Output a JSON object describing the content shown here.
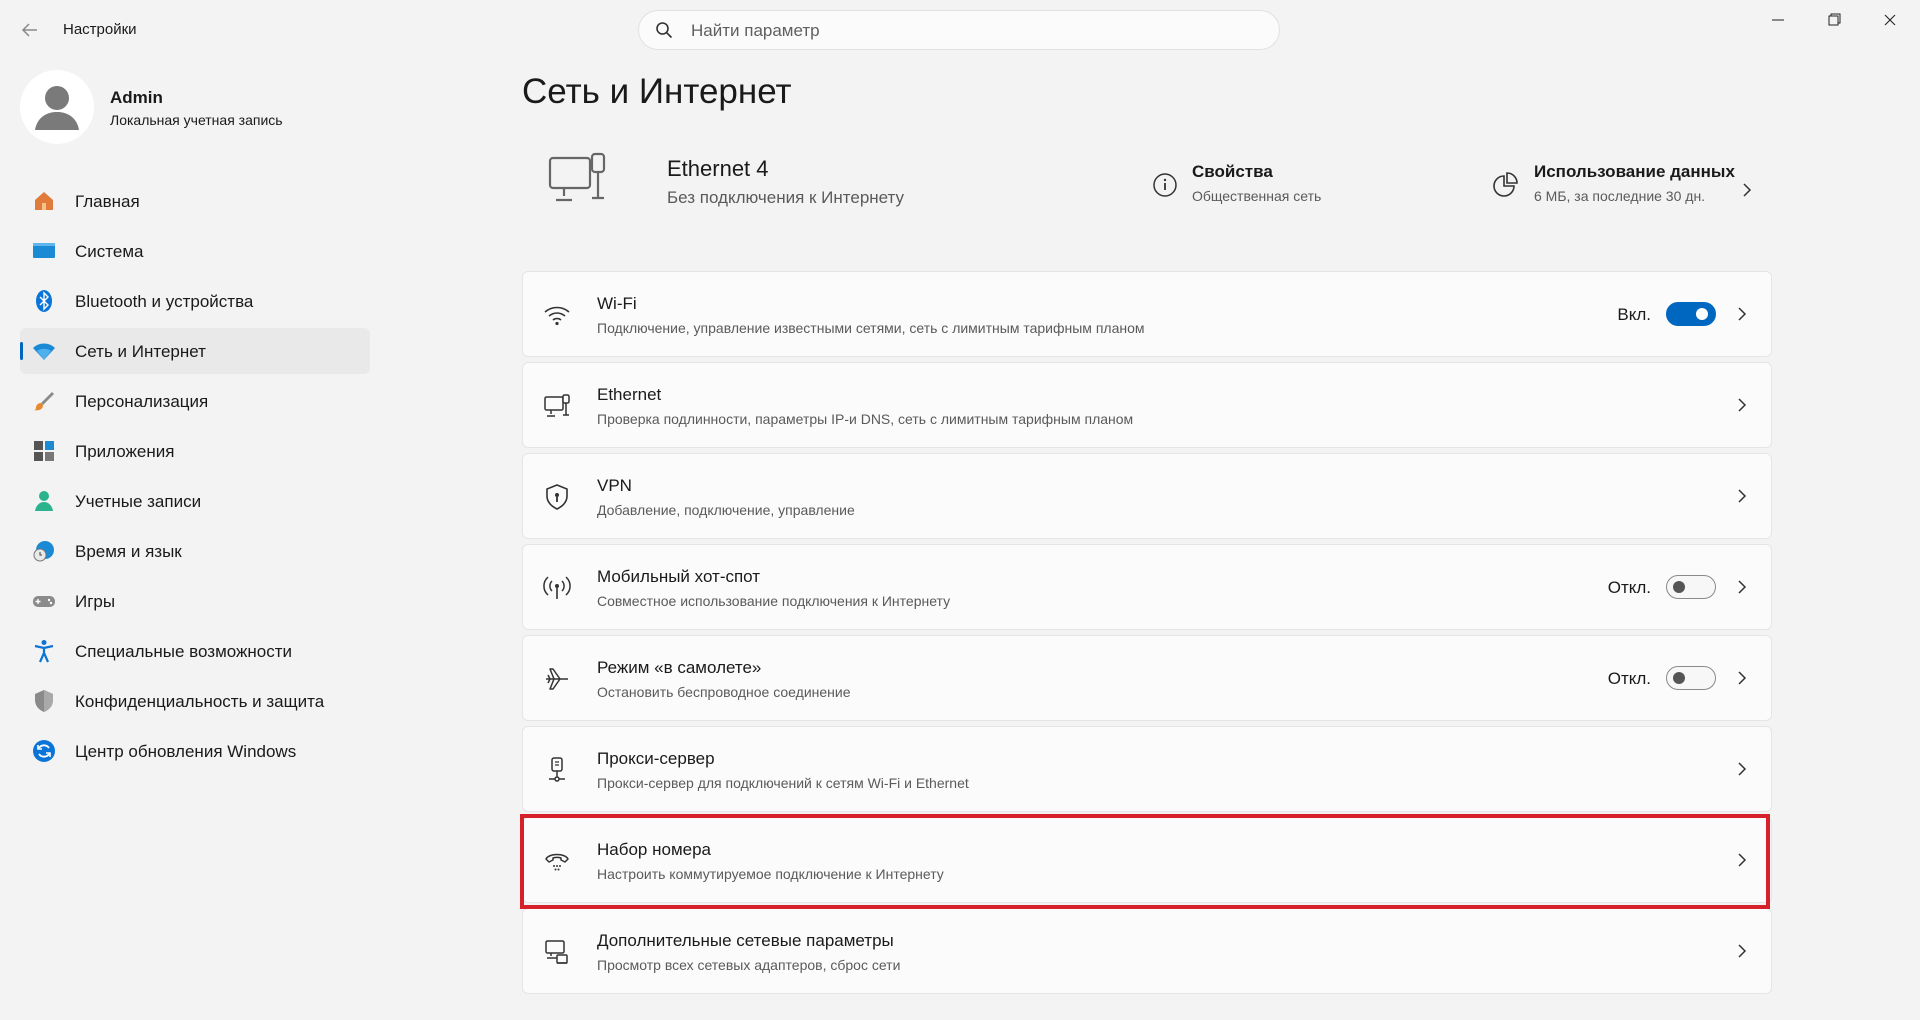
{
  "window": {
    "app_title": "Настройки",
    "search_placeholder": "Найти параметр"
  },
  "profile": {
    "name": "Admin",
    "account_type": "Локальная учетная запись"
  },
  "sidebar": {
    "items": [
      {
        "label": "Главная",
        "icon": "home-icon"
      },
      {
        "label": "Система",
        "icon": "system-icon"
      },
      {
        "label": "Bluetooth и устройства",
        "icon": "bluetooth-icon"
      },
      {
        "label": "Сеть и Интернет",
        "icon": "network-icon",
        "active": true
      },
      {
        "label": "Персонализация",
        "icon": "brush-icon"
      },
      {
        "label": "Приложения",
        "icon": "apps-icon"
      },
      {
        "label": "Учетные записи",
        "icon": "account-icon"
      },
      {
        "label": "Время и язык",
        "icon": "globe-clock-icon"
      },
      {
        "label": "Игры",
        "icon": "gamepad-icon"
      },
      {
        "label": "Специальные возможности",
        "icon": "accessibility-icon"
      },
      {
        "label": "Конфиденциальность и защита",
        "icon": "shield-icon"
      },
      {
        "label": "Центр обновления Windows",
        "icon": "update-icon"
      }
    ]
  },
  "main": {
    "title": "Сеть и Интернет",
    "device": {
      "name": "Ethernet 4",
      "status": "Без подключения к Интернету",
      "properties_title": "Свойства",
      "properties_sub": "Общественная сеть",
      "usage_title": "Использование данных",
      "usage_sub": "6 МБ, за последние 30 дн."
    },
    "rows": [
      {
        "title": "Wi-Fi",
        "sub": "Подключение, управление известными сетями, сеть с лимитным тарифным планом",
        "icon": "wifi-icon",
        "toggle_label": "Вкл.",
        "toggle": "on"
      },
      {
        "title": "Ethernet",
        "sub": "Проверка подлинности, параметры IP-и DNS, сеть с лимитным тарифным планом",
        "icon": "ethernet-icon"
      },
      {
        "title": "VPN",
        "sub": "Добавление, подключение, управление",
        "icon": "vpn-shield-icon"
      },
      {
        "title": "Мобильный хот-спот",
        "sub": "Совместное использование подключения к Интернету",
        "icon": "hotspot-icon",
        "toggle_label": "Откл.",
        "toggle": "off"
      },
      {
        "title": "Режим «в самолете»",
        "sub": "Остановить беспроводное соединение",
        "icon": "airplane-icon",
        "toggle_label": "Откл.",
        "toggle": "off"
      },
      {
        "title": "Прокси-сервер",
        "sub": "Прокси-сервер для подключений к сетям Wi-Fi и Ethernet",
        "icon": "proxy-icon"
      },
      {
        "title": "Набор номера",
        "sub": "Настроить коммутируемое подключение к Интернету",
        "icon": "dialup-icon",
        "highlighted": true
      },
      {
        "title": "Дополнительные сетевые параметры",
        "sub": "Просмотр всех сетевых адаптеров, сброс сети",
        "icon": "advanced-network-icon"
      }
    ]
  },
  "colors": {
    "accent": "#0067c0",
    "highlight": "#d6202a"
  }
}
